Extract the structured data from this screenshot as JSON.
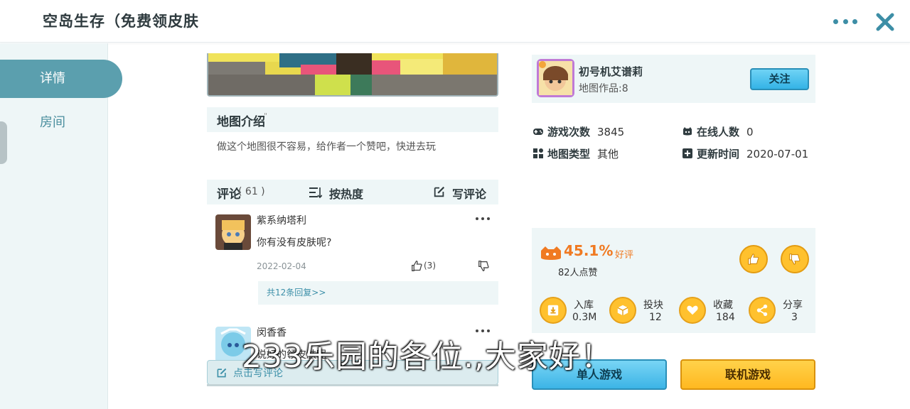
{
  "header": {
    "title": "空岛生存（免费领皮肤"
  },
  "sidebar": {
    "tabs": [
      {
        "label": "详情"
      },
      {
        "label": "房间"
      }
    ]
  },
  "intro": {
    "title": "地图介绍",
    "title_mark": "\"",
    "text": "做这个地图很不容易，给作者一个赞吧，快进去玩"
  },
  "comments": {
    "title": "评论",
    "count": "( 61 )",
    "sort_label": "按热度",
    "write_label": "写评论",
    "items": [
      {
        "name": "紫系纳塔利",
        "text": "你有没有皮肤呢?",
        "date": "2022-02-04",
        "likes": "(3)",
        "replies": "共12条回复>>"
      },
      {
        "name": "闵香香",
        "text": "说好的领皮肤呢"
      }
    ],
    "write_placeholder": "点击写评论"
  },
  "author": {
    "name": "初号机艾谱莉",
    "works": "地图作品:8",
    "follow_label": "关注"
  },
  "stats": {
    "plays_label": "游戏次数",
    "plays": "3845",
    "online_label": "在线人数",
    "online": "0",
    "type_label": "地图类型",
    "type": "其他",
    "updated_label": "更新时间",
    "updated": "2020-07-01"
  },
  "rating": {
    "percent": "45.1%",
    "label": "好评",
    "likes": "82人点赞"
  },
  "actions": [
    {
      "label": "入库",
      "value": "0.3M"
    },
    {
      "label": "投块",
      "value": "12"
    },
    {
      "label": "收藏",
      "value": "184"
    },
    {
      "label": "分享",
      "value": "3"
    }
  ],
  "buttons": {
    "single": "单人游戏",
    "multi": "联机游戏"
  },
  "subtitle": "233乐园的各位.,大家好！",
  "colors": {
    "accent": "#5b9fae",
    "link": "#3b8fa8",
    "orange": "#f07a22",
    "gold": "#ffc12e",
    "blue": "#3cb4e6"
  }
}
